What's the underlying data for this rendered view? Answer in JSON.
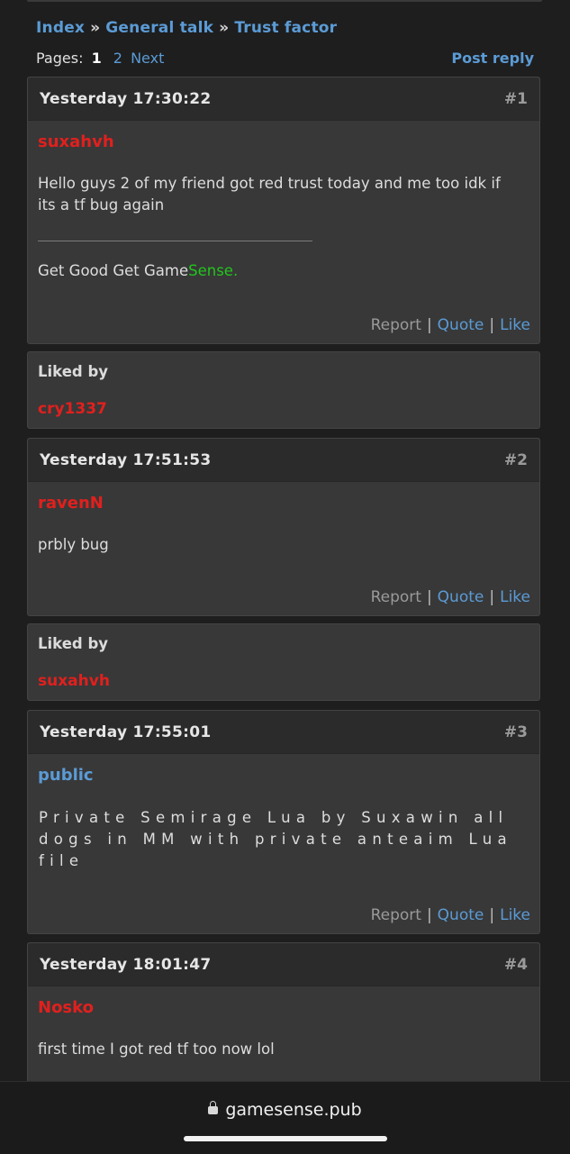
{
  "breadcrumb": {
    "items": [
      "Index",
      "General talk",
      "Trust factor"
    ],
    "separator": "»"
  },
  "pagination": {
    "label": "Pages:",
    "current": "1",
    "pages": [
      "2"
    ],
    "next": "Next"
  },
  "post_reply_label": "Post reply",
  "actions": {
    "report": "Report",
    "quote": "Quote",
    "like": "Like",
    "separator": "|"
  },
  "liked_by_label": "Liked by",
  "posts": [
    {
      "time": "Yesterday 17:30:22",
      "number": "#1",
      "author": "suxahvh",
      "author_color": "#e0201e",
      "text": "Hello guys 2 of my friend got red trust today and me too idk if its a tf bug again",
      "signature": {
        "prefix": "Get Good Get Game",
        "suffix": "Sense.",
        "suffix_color": "#22c51e"
      },
      "liked_by": [
        "cry1337"
      ]
    },
    {
      "time": "Yesterday 17:51:53",
      "number": "#2",
      "author": "ravenN",
      "author_color": "#e0201e",
      "text": "prbly bug",
      "liked_by": [
        "suxahvh"
      ]
    },
    {
      "time": "Yesterday 17:55:01",
      "number": "#3",
      "author": "public",
      "author_color": "#5b9bd5",
      "text": "Private Semirage Lua by Suxawin all dogs in MM with private anteaim Lua file"
    },
    {
      "time": "Yesterday 18:01:47",
      "number": "#4",
      "author": "Nosko",
      "author_color": "#e0201e",
      "text": "first time I got red tf too now lol"
    }
  ],
  "browser": {
    "url": "gamesense.pub"
  }
}
